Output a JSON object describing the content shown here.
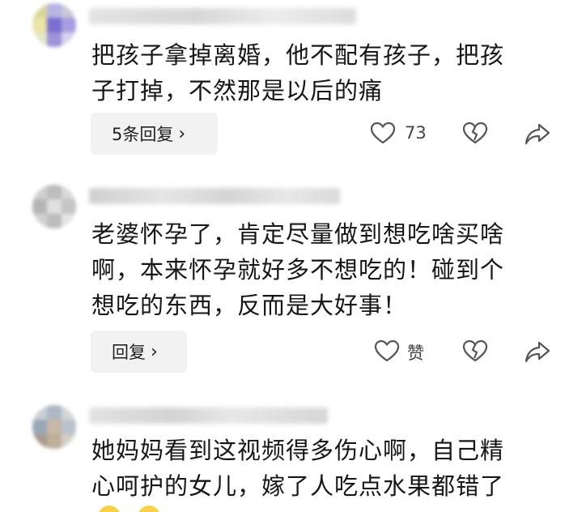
{
  "comments": [
    {
      "text_lines": [
        "把孩子拿掉离婚，他不配有孩子，把孩",
        "子打掉，不然那是以后的痛"
      ],
      "reply_label": "5条回复",
      "like_count": "73"
    },
    {
      "text_lines": [
        "老婆怀孕了，肯定尽量做到想吃啥买啥",
        "啊，本来怀孕就好多不想吃的！碰到个",
        "想吃的东西，反而是大好事！"
      ],
      "reply_label": "回复",
      "like_count": "赞"
    },
    {
      "text_lines": [
        "她妈妈看到这视频得多伤心啊，自己精",
        "心呵护的女儿，嫁了人吃点水果都错了"
      ]
    }
  ],
  "icons": {
    "like": "heart-icon",
    "dislike": "broken-heart-icon",
    "share": "share-arrow-icon",
    "reply_chevron": "chevron-right-icon"
  },
  "colors": {
    "reply_bg": "#f2f2f2",
    "icon_stroke": "#555555",
    "text": "#161616"
  }
}
